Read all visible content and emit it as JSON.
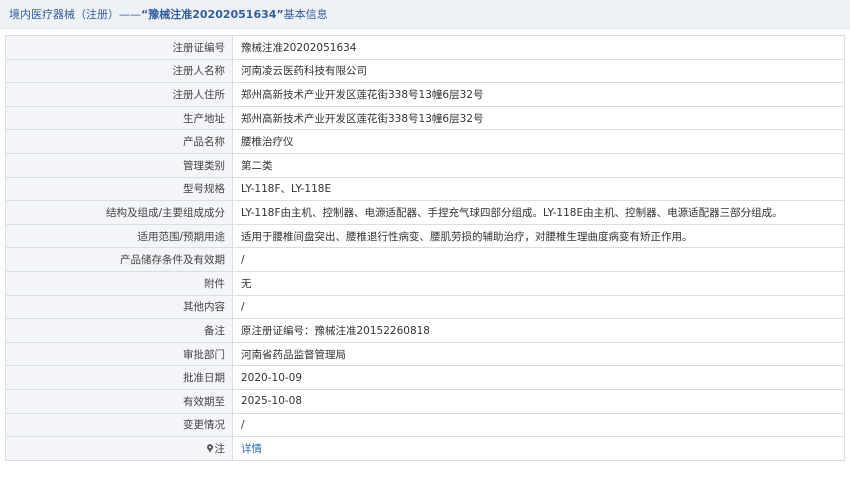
{
  "header": {
    "prefix": "境内医疗器械（注册）——",
    "highlight": "“豫械注准20202051634”",
    "suffix": "基本信息"
  },
  "rows": [
    {
      "label": "注册证编号",
      "value": "豫械注准20202051634"
    },
    {
      "label": "注册人名称",
      "value": "河南凌云医药科技有限公司"
    },
    {
      "label": "注册人住所",
      "value": "郑州高新技术产业开发区莲花街338号13幢6层32号"
    },
    {
      "label": "生产地址",
      "value": "郑州高新技术产业开发区莲花街338号13幢6层32号"
    },
    {
      "label": "产品名称",
      "value": "腰椎治疗仪"
    },
    {
      "label": "管理类别",
      "value": "第二类"
    },
    {
      "label": "型号规格",
      "value": "LY-118F、LY-118E"
    },
    {
      "label": "结构及组成/主要组成成分",
      "value": "LY-118F由主机、控制器、电源适配器、手捏充气球四部分组成。LY-118E由主机、控制器、电源适配器三部分组成。"
    },
    {
      "label": "适用范围/预期用途",
      "value": "适用于腰椎间盘突出、腰椎退行性病变、腰肌劳损的辅助治疗，对腰椎生理曲度病变有矫正作用。"
    },
    {
      "label": "产品储存条件及有效期",
      "value": "/"
    },
    {
      "label": "附件",
      "value": "无"
    },
    {
      "label": "其他内容",
      "value": "/"
    },
    {
      "label": "备注",
      "value": "原注册证编号：豫械注准20152260818"
    },
    {
      "label": "审批部门",
      "value": "河南省药品监督管理局"
    },
    {
      "label": "批准日期",
      "value": "2020-10-09"
    },
    {
      "label": "有效期至",
      "value": "2025-10-08"
    },
    {
      "label": "变更情况",
      "value": "/"
    }
  ],
  "note_row": {
    "icon": "pin-icon",
    "label": "注",
    "link": "详情"
  },
  "colors": {
    "header_bg": "#eef1f6",
    "header_text": "#355e9b",
    "label_bg": "#f3f5f8",
    "border": "#d9dee6",
    "link": "#2e6fb8"
  }
}
